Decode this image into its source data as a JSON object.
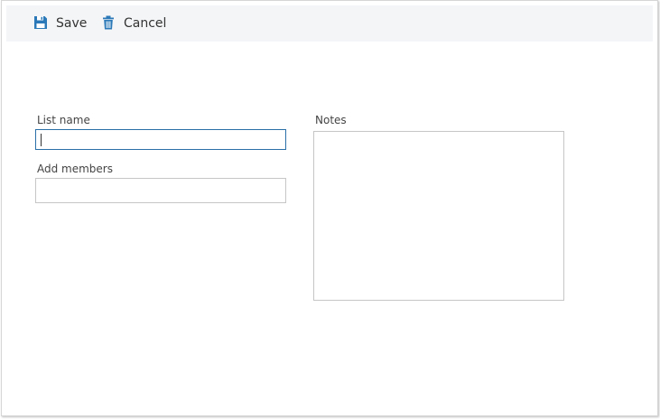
{
  "toolbar": {
    "save_label": "Save",
    "save_icon": "floppy-disk-icon",
    "cancel_label": "Cancel",
    "cancel_icon": "trash-can-icon",
    "icon_color": "#2b79b8"
  },
  "form": {
    "list_name": {
      "label": "List name",
      "value": ""
    },
    "add_members": {
      "label": "Add members",
      "value": ""
    },
    "notes": {
      "label": "Notes",
      "value": ""
    }
  }
}
